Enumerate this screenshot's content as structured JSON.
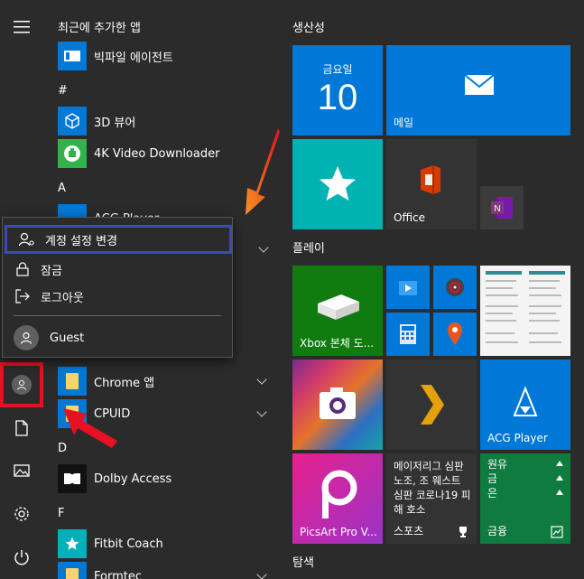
{
  "app_list": {
    "recent_header": "최근에 추가한 앱",
    "recent_item": "빅파일 에이전트",
    "hash_header": "#",
    "hash_items": [
      "3D 뷰어",
      "4K Video Downloader"
    ],
    "a_header": "A",
    "a_partial_item": "ACG Player",
    "folder_chrome": "Chrome 앱",
    "folder_cpuid": "CPUID",
    "d_header": "D",
    "dolby": "Dolby Access",
    "f_header": "F",
    "fitbit": "Fitbit Coach",
    "formtec": "Formtec"
  },
  "account_menu": {
    "change_settings": "계정 설정 변경",
    "lock": "잠금",
    "sign_out": "로그아웃",
    "guest": "Guest"
  },
  "tiles": {
    "group_productivity": "생산성",
    "calendar_day": "금요일",
    "calendar_date": "10",
    "mail": "메일",
    "office": "Office",
    "group_play": "플레이",
    "xbox": "Xbox 본체 도...",
    "acg_player": "ACG Player",
    "picsart": "PicsArt Pro V...",
    "news_text": "메이저리그 심판 노조, 조 웨스트 심판 코로나19 피해 호소",
    "news_label": "스포츠",
    "stocks_rows": [
      "원유",
      "금",
      "은"
    ],
    "finance": "금융",
    "group_explore": "탐색"
  },
  "colors": {
    "accent_blue": "#0078d7",
    "highlight_border": "#3a4ab7",
    "red_highlight": "#e81123",
    "arrow_orange": "#f7931e"
  }
}
